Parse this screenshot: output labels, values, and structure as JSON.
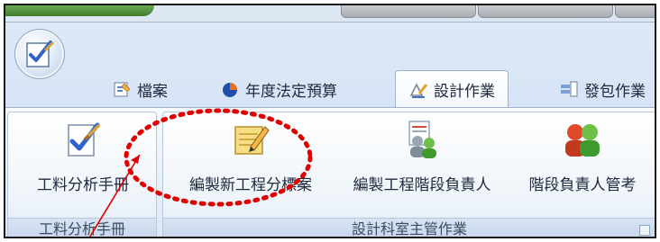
{
  "ribbon": {
    "tabs": [
      {
        "label": "檔案",
        "icon": "file-properties-icon"
      },
      {
        "label": "年度法定預算",
        "icon": "pie-chart-icon"
      },
      {
        "label": "設計作業",
        "icon": "design-tools-icon",
        "active": true
      },
      {
        "label": "發包作業",
        "icon": "tender-icon"
      }
    ],
    "groups": [
      {
        "label": "工料分析手冊",
        "buttons": [
          {
            "label": "工料分析手冊",
            "icon": "document-check-icon"
          }
        ]
      },
      {
        "label": "設計科室主管作業",
        "buttons": [
          {
            "label": "編製新工程分標案",
            "icon": "notepad-pencil-icon"
          },
          {
            "label": "編製工程階段負責人",
            "icon": "document-people-icon"
          },
          {
            "label": "階段負責人管考",
            "icon": "people-icon"
          }
        ]
      }
    ]
  },
  "colors": {
    "annotation_red": "#e00000",
    "ribbon_blue": "#d3e2f5"
  }
}
